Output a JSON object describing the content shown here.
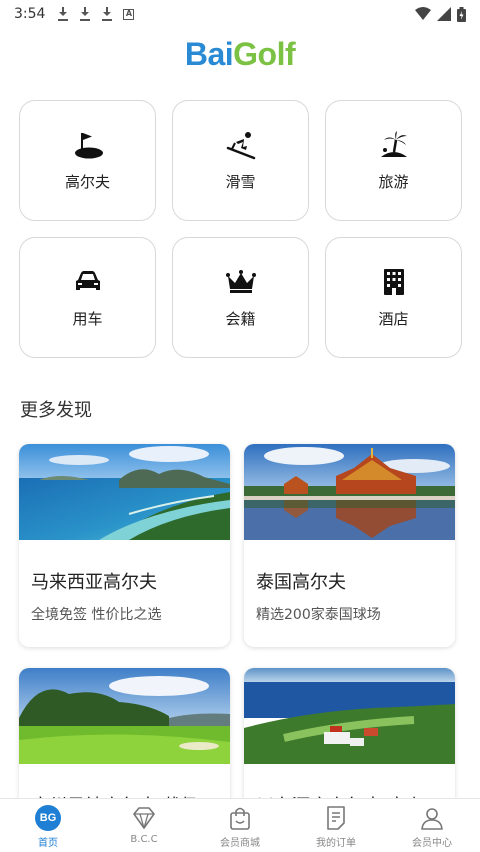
{
  "status_bar": {
    "time": "3:54"
  },
  "logo": {
    "part1": "Bai",
    "part2": "Golf"
  },
  "categories": [
    {
      "label": "高尔夫",
      "icon": "golf-flag-icon"
    },
    {
      "label": "滑雪",
      "icon": "skier-icon"
    },
    {
      "label": "旅游",
      "icon": "island-palm-icon"
    },
    {
      "label": "用车",
      "icon": "car-icon"
    },
    {
      "label": "会籍",
      "icon": "crown-icon"
    },
    {
      "label": "酒店",
      "icon": "hotel-building-icon"
    }
  ],
  "section": {
    "title": "更多发现"
  },
  "cards": [
    {
      "title": "马来西亚高尔夫",
      "subtitle": "全境免签 性价比之选"
    },
    {
      "title": "泰国高尔夫",
      "subtitle": "精选200家泰国球场"
    },
    {
      "title": "广州风神高尔夫 截仍",
      "subtitle": ""
    },
    {
      "title": "川东酒店高尔夫 官上",
      "subtitle": ""
    }
  ],
  "bottom_nav": [
    {
      "label": "首页",
      "icon": "bg-logo-icon",
      "active": true,
      "badge": "BG"
    },
    {
      "label": "B.C.C",
      "icon": "diamond-icon",
      "active": false
    },
    {
      "label": "会员商城",
      "icon": "shopping-bag-icon",
      "active": false
    },
    {
      "label": "我的订单",
      "icon": "order-list-icon",
      "active": false
    },
    {
      "label": "会员中心",
      "icon": "user-icon",
      "active": false
    }
  ],
  "colors": {
    "accent": "#1e7fd4",
    "logo_blue": "#2a8bd4",
    "logo_green": "#7bc143"
  }
}
